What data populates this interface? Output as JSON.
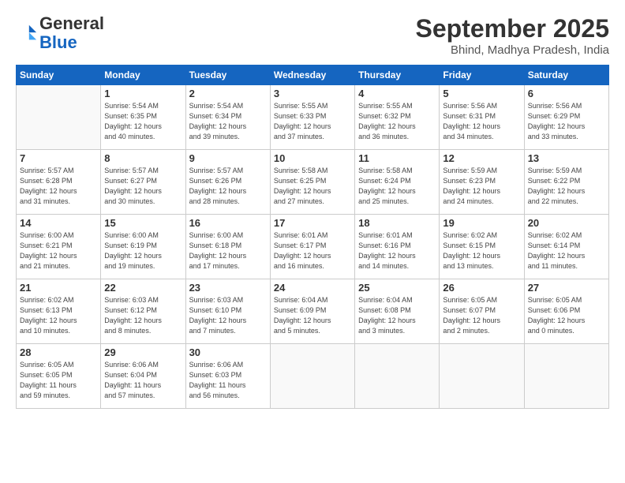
{
  "logo": {
    "line1": "General",
    "line2": "Blue"
  },
  "title": "September 2025",
  "subtitle": "Bhind, Madhya Pradesh, India",
  "weekdays": [
    "Sunday",
    "Monday",
    "Tuesday",
    "Wednesday",
    "Thursday",
    "Friday",
    "Saturday"
  ],
  "weeks": [
    [
      {
        "day": "",
        "info": ""
      },
      {
        "day": "1",
        "info": "Sunrise: 5:54 AM\nSunset: 6:35 PM\nDaylight: 12 hours\nand 40 minutes."
      },
      {
        "day": "2",
        "info": "Sunrise: 5:54 AM\nSunset: 6:34 PM\nDaylight: 12 hours\nand 39 minutes."
      },
      {
        "day": "3",
        "info": "Sunrise: 5:55 AM\nSunset: 6:33 PM\nDaylight: 12 hours\nand 37 minutes."
      },
      {
        "day": "4",
        "info": "Sunrise: 5:55 AM\nSunset: 6:32 PM\nDaylight: 12 hours\nand 36 minutes."
      },
      {
        "day": "5",
        "info": "Sunrise: 5:56 AM\nSunset: 6:31 PM\nDaylight: 12 hours\nand 34 minutes."
      },
      {
        "day": "6",
        "info": "Sunrise: 5:56 AM\nSunset: 6:29 PM\nDaylight: 12 hours\nand 33 minutes."
      }
    ],
    [
      {
        "day": "7",
        "info": "Sunrise: 5:57 AM\nSunset: 6:28 PM\nDaylight: 12 hours\nand 31 minutes."
      },
      {
        "day": "8",
        "info": "Sunrise: 5:57 AM\nSunset: 6:27 PM\nDaylight: 12 hours\nand 30 minutes."
      },
      {
        "day": "9",
        "info": "Sunrise: 5:57 AM\nSunset: 6:26 PM\nDaylight: 12 hours\nand 28 minutes."
      },
      {
        "day": "10",
        "info": "Sunrise: 5:58 AM\nSunset: 6:25 PM\nDaylight: 12 hours\nand 27 minutes."
      },
      {
        "day": "11",
        "info": "Sunrise: 5:58 AM\nSunset: 6:24 PM\nDaylight: 12 hours\nand 25 minutes."
      },
      {
        "day": "12",
        "info": "Sunrise: 5:59 AM\nSunset: 6:23 PM\nDaylight: 12 hours\nand 24 minutes."
      },
      {
        "day": "13",
        "info": "Sunrise: 5:59 AM\nSunset: 6:22 PM\nDaylight: 12 hours\nand 22 minutes."
      }
    ],
    [
      {
        "day": "14",
        "info": "Sunrise: 6:00 AM\nSunset: 6:21 PM\nDaylight: 12 hours\nand 21 minutes."
      },
      {
        "day": "15",
        "info": "Sunrise: 6:00 AM\nSunset: 6:19 PM\nDaylight: 12 hours\nand 19 minutes."
      },
      {
        "day": "16",
        "info": "Sunrise: 6:00 AM\nSunset: 6:18 PM\nDaylight: 12 hours\nand 17 minutes."
      },
      {
        "day": "17",
        "info": "Sunrise: 6:01 AM\nSunset: 6:17 PM\nDaylight: 12 hours\nand 16 minutes."
      },
      {
        "day": "18",
        "info": "Sunrise: 6:01 AM\nSunset: 6:16 PM\nDaylight: 12 hours\nand 14 minutes."
      },
      {
        "day": "19",
        "info": "Sunrise: 6:02 AM\nSunset: 6:15 PM\nDaylight: 12 hours\nand 13 minutes."
      },
      {
        "day": "20",
        "info": "Sunrise: 6:02 AM\nSunset: 6:14 PM\nDaylight: 12 hours\nand 11 minutes."
      }
    ],
    [
      {
        "day": "21",
        "info": "Sunrise: 6:02 AM\nSunset: 6:13 PM\nDaylight: 12 hours\nand 10 minutes."
      },
      {
        "day": "22",
        "info": "Sunrise: 6:03 AM\nSunset: 6:12 PM\nDaylight: 12 hours\nand 8 minutes."
      },
      {
        "day": "23",
        "info": "Sunrise: 6:03 AM\nSunset: 6:10 PM\nDaylight: 12 hours\nand 7 minutes."
      },
      {
        "day": "24",
        "info": "Sunrise: 6:04 AM\nSunset: 6:09 PM\nDaylight: 12 hours\nand 5 minutes."
      },
      {
        "day": "25",
        "info": "Sunrise: 6:04 AM\nSunset: 6:08 PM\nDaylight: 12 hours\nand 3 minutes."
      },
      {
        "day": "26",
        "info": "Sunrise: 6:05 AM\nSunset: 6:07 PM\nDaylight: 12 hours\nand 2 minutes."
      },
      {
        "day": "27",
        "info": "Sunrise: 6:05 AM\nSunset: 6:06 PM\nDaylight: 12 hours\nand 0 minutes."
      }
    ],
    [
      {
        "day": "28",
        "info": "Sunrise: 6:05 AM\nSunset: 6:05 PM\nDaylight: 11 hours\nand 59 minutes."
      },
      {
        "day": "29",
        "info": "Sunrise: 6:06 AM\nSunset: 6:04 PM\nDaylight: 11 hours\nand 57 minutes."
      },
      {
        "day": "30",
        "info": "Sunrise: 6:06 AM\nSunset: 6:03 PM\nDaylight: 11 hours\nand 56 minutes."
      },
      {
        "day": "",
        "info": ""
      },
      {
        "day": "",
        "info": ""
      },
      {
        "day": "",
        "info": ""
      },
      {
        "day": "",
        "info": ""
      }
    ]
  ]
}
